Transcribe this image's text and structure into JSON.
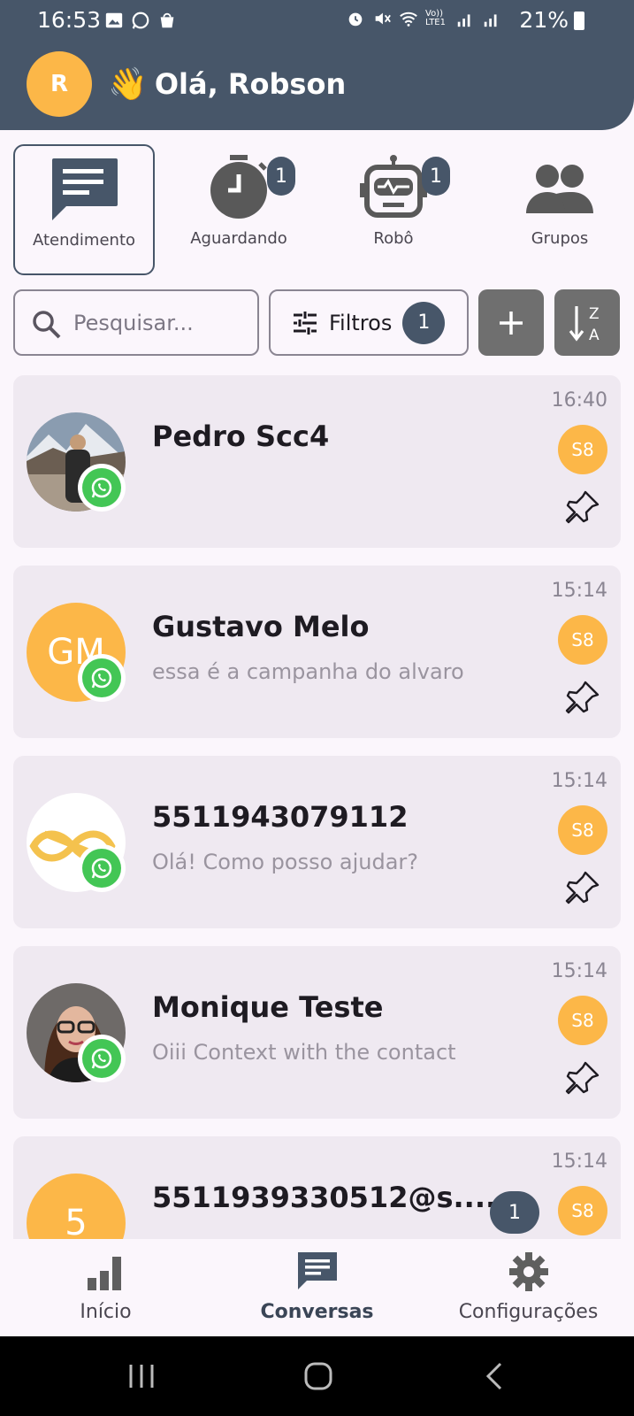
{
  "status_bar": {
    "time": "16:53",
    "battery": "21%",
    "network": "Vo)) LTE1"
  },
  "header": {
    "avatar_initial": "R",
    "wave_emoji": "👋",
    "greeting": "Olá, Robson"
  },
  "categories": [
    {
      "label": "Atendimento",
      "icon": "chat-icon",
      "active": true,
      "badge": null
    },
    {
      "label": "Aguardando",
      "icon": "stopwatch-icon",
      "active": false,
      "badge": "1"
    },
    {
      "label": "Robô",
      "icon": "robot-icon",
      "active": false,
      "badge": "1"
    },
    {
      "label": "Grupos",
      "icon": "group-icon",
      "active": false,
      "badge": null
    }
  ],
  "search": {
    "placeholder": "Pesquisar..."
  },
  "filters": {
    "label": "Filtros",
    "count": "1"
  },
  "actions": {
    "add_icon": "plus-icon",
    "sort_icon": "sort-za-icon"
  },
  "conversations": [
    {
      "name": "Pedro Scc4",
      "message": "",
      "time": "16:40",
      "sector": "S8",
      "unread": null,
      "avatar": "photo-man"
    },
    {
      "name": "Gustavo Melo",
      "message": "essa é a campanha do alvaro",
      "time": "15:14",
      "sector": "S8",
      "unread": null,
      "avatar_initials": "GM"
    },
    {
      "name": "5511943079112",
      "message": "Olá! Como posso ajudar?",
      "time": "15:14",
      "sector": "S8",
      "unread": null,
      "avatar": "logo-infinity"
    },
    {
      "name": "Monique Teste",
      "message": "Oiii Context with the contact",
      "time": "15:14",
      "sector": "S8",
      "unread": null,
      "avatar": "photo-woman"
    },
    {
      "name": "5511939330512@s....",
      "message": "",
      "time": "15:14",
      "sector": "S8",
      "unread": "1",
      "avatar_initials": "5"
    }
  ],
  "bottom_nav": [
    {
      "label": "Início",
      "icon": "bar-chart-icon",
      "active": false
    },
    {
      "label": "Conversas",
      "icon": "chat-icon",
      "active": true
    },
    {
      "label": "Configurações",
      "icon": "gear-icon",
      "active": false
    }
  ],
  "colors": {
    "primary": "#475669",
    "accent": "#fcb748",
    "whatsapp": "#43c655",
    "background": "#fbf6fc",
    "card": "#efe9f1"
  }
}
